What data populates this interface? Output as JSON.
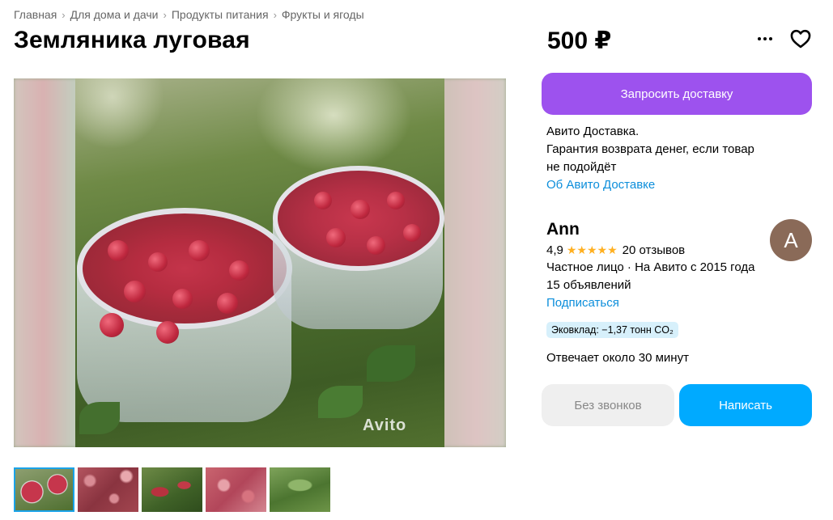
{
  "breadcrumb": [
    "Главная",
    "Для дома и дачи",
    "Продукты питания",
    "Фрукты и ягоды"
  ],
  "listing": {
    "title": "Земляника луговая",
    "price": "500 ₽",
    "watermark": "Avito"
  },
  "actions": {
    "more_icon": "more-dots-icon",
    "favorite_icon": "heart-icon"
  },
  "delivery": {
    "button_label": "Запросить доставку",
    "line1": "Авито Доставка.",
    "line2": "Гарантия возврата денег, если товар",
    "line3": "не подойдёт",
    "link": "Об Авито Доставке"
  },
  "seller": {
    "name": "Ann",
    "avatar_letter": "A",
    "rating": "4,9",
    "stars": "★★★★★",
    "reviews": "20 отзывов",
    "type_line": "Частное лицо · На Авито с 2015 года",
    "listings": "15 объявлений",
    "subscribe": "Подписаться",
    "eco": "Эковклад: −1,37 тонн CO₂",
    "response": "Отвечает около 30 минут"
  },
  "contact": {
    "no_calls": "Без звонков",
    "write": "Написать"
  },
  "colors": {
    "delivery_button": "#9d52ee",
    "write_button": "#00aaff",
    "link": "#0c8edb",
    "stars": "#ffb021",
    "eco_badge": "#d7f0fb"
  },
  "thumbnails_count": 5
}
